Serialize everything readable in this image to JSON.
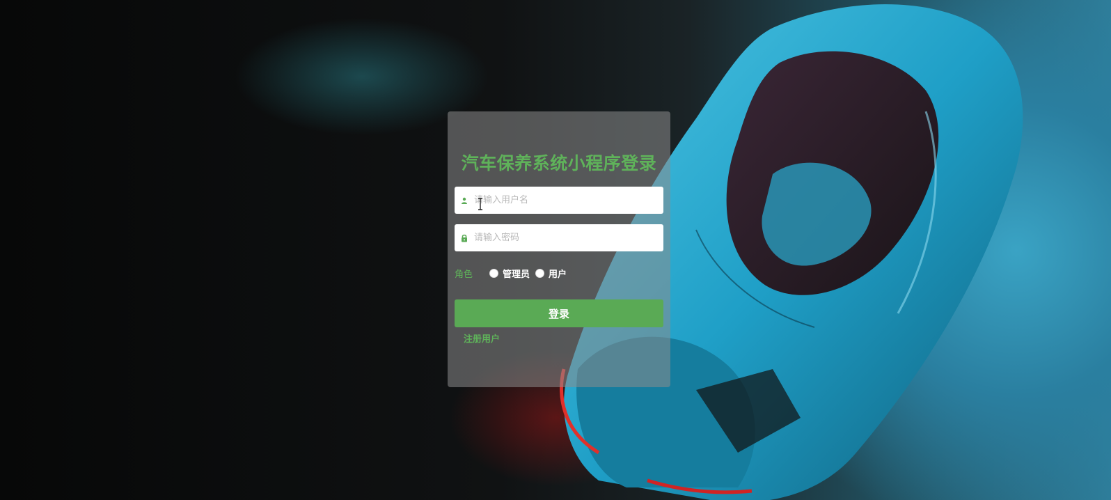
{
  "page": {
    "title": "汽车保养系统小程序登录"
  },
  "form": {
    "username_placeholder": "请输入用户名",
    "username_value": "",
    "password_placeholder": "请输入密码",
    "password_value": "",
    "role_label": "角色",
    "roles": [
      {
        "label": "管理员",
        "selected": false
      },
      {
        "label": "用户",
        "selected": false
      }
    ],
    "submit_label": "登录",
    "register_label": "注册用户"
  },
  "icons": {
    "username": "user-icon",
    "password": "lock-icon"
  },
  "colors": {
    "accent": "#5aaa55",
    "title": "#5fb25a",
    "panel": "rgba(140,140,140,0.55)"
  }
}
